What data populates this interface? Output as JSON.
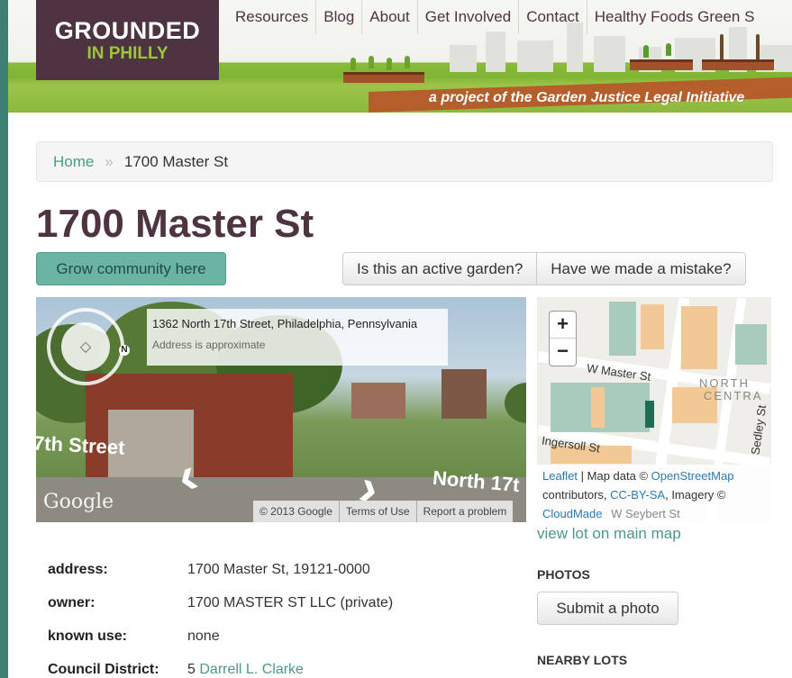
{
  "site": {
    "logo_line1": "GROUNDED",
    "logo_line2": "IN PHILLY",
    "tagline": "a project of the Garden Justice Legal Initiative"
  },
  "nav": {
    "items": [
      "Resources",
      "Blog",
      "About",
      "Get Involved",
      "Contact",
      "Healthy Foods Green S"
    ]
  },
  "breadcrumb": {
    "home": "Home",
    "separator": "»",
    "current": "1700 Master St"
  },
  "page": {
    "title": "1700 Master St"
  },
  "actions": {
    "grow": "Grow community here",
    "active_garden": "Is this an active garden?",
    "mistake": "Have we made a mistake?"
  },
  "streetview": {
    "address": "1362 North 17th Street, Philadelphia, Pennsylvania",
    "approx": "Address is approximate",
    "street_left": "7th Street",
    "street_right": "North 17t",
    "compass_n": "N",
    "google": "Google",
    "footer": [
      "© 2013 Google",
      "Terms of Use",
      "Report a problem"
    ]
  },
  "map": {
    "zoom_in": "+",
    "zoom_out": "−",
    "labels": {
      "master": "W Master St",
      "ingersoll": "Ingersoll St",
      "north_central_1": "NORTH",
      "north_central_2": "CENTRA",
      "st_17": "St",
      "sedley": "Sedley St",
      "seybert": "W Seybert St"
    },
    "attribution": {
      "leaflet": "Leaflet",
      "map_data": " | Map data © ",
      "osm": "OpenStreetMap",
      "contributors": "contributors, ",
      "license": "CC-BY-SA",
      "imagery": ", Imagery ©",
      "cloudmade": "CloudMade"
    },
    "view_lot": "view lot on main map"
  },
  "details": {
    "address_label": "address:",
    "address_value": "1700 Master St, 19121-0000",
    "owner_label": "owner:",
    "owner_value": "1700 MASTER ST LLC (private)",
    "use_label": "known use:",
    "use_value": "none",
    "council_label": "Council District:",
    "council_number": "5",
    "council_member": "Darrell L. Clarke"
  },
  "sidebar": {
    "photos_heading": "PHOTOS",
    "submit_photo": "Submit a photo",
    "nearby_heading": "NEARBY LOTS"
  },
  "colors": {
    "brand_plum": "#4e3340",
    "accent_teal": "#4a9a89",
    "grow_button": "#6bb3a2"
  }
}
